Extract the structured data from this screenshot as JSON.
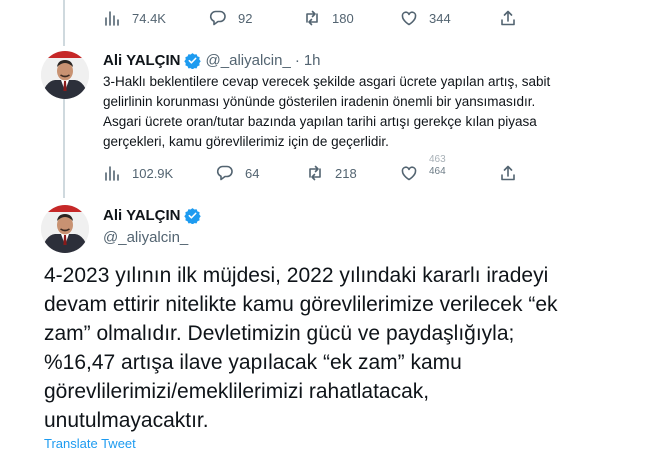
{
  "top_tweet_actions": {
    "views": "74.4K",
    "replies": "92",
    "retweets": "180",
    "likes": "344"
  },
  "reply_tweet": {
    "author_name": "Ali YALÇIN",
    "handle": "@_aliyalcin_",
    "separator": "·",
    "time": "1h",
    "lines": [
      "3-Haklı beklentilere cevap verecek şekilde asgari ücrete yapılan artış, sabit",
      "gelirlinin korunması yönünde gösterilen iradenin önemli bir yansımasıdır.",
      "Asgari ücrete oran/tutar bazında yapılan tarihi artışı gerekçe kılan piyasa",
      "gerçekleri, kamu görevlilerimiz için de geçerlidir."
    ],
    "actions": {
      "views": "102.9K",
      "replies": "64",
      "retweets": "218",
      "likes_old": "463",
      "likes": "464"
    }
  },
  "main_tweet": {
    "author_name": "Ali YALÇIN",
    "handle": "@_aliyalcin_",
    "lines": [
      "4-2023 yılının ilk müjdesi, 2022 yılındaki kararlı iradeyi",
      "devam ettirir nitelikte kamu görevlilerimize verilecek “ek",
      "zam” olmalıdır. Devletimizin gücü ve paydaşlığıyla;",
      "%16,47 artışa ilave yapılacak “ek zam” kamu",
      "görevlilerimizi/emeklilerimizi rahatlatacak,",
      "unutulmayacaktır."
    ],
    "translate_label": "Translate Tweet"
  },
  "colors": {
    "accent": "#1d9bf0",
    "secondary_text": "#536471",
    "divider": "#cfd9de"
  }
}
